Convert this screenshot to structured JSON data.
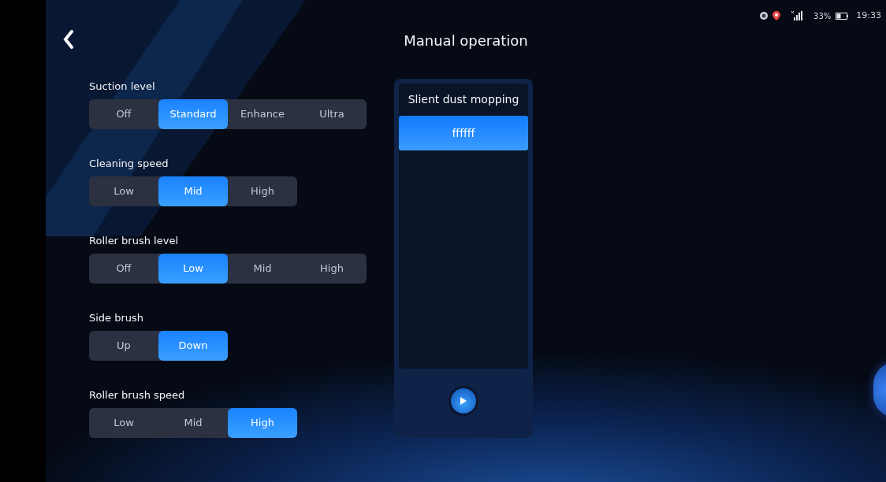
{
  "header": {
    "title": "Manual operation"
  },
  "status_bar": {
    "battery": "33%",
    "time": "19:33"
  },
  "settings": [
    {
      "label": "Suction level",
      "options": [
        {
          "label": "Off",
          "selected": false
        },
        {
          "label": "Standard",
          "selected": true
        },
        {
          "label": "Enhance",
          "selected": false
        },
        {
          "label": "Ultra",
          "selected": false
        }
      ]
    },
    {
      "label": "Cleaning speed",
      "options": [
        {
          "label": "Low",
          "selected": false
        },
        {
          "label": "Mid",
          "selected": true
        },
        {
          "label": "High",
          "selected": false
        }
      ]
    },
    {
      "label": "Roller brush level",
      "options": [
        {
          "label": "Off",
          "selected": false
        },
        {
          "label": "Low",
          "selected": true
        },
        {
          "label": "Mid",
          "selected": false
        },
        {
          "label": "High",
          "selected": false
        }
      ]
    },
    {
      "label": "Side brush",
      "options": [
        {
          "label": "Up",
          "selected": false
        },
        {
          "label": "Down",
          "selected": true
        }
      ]
    },
    {
      "label": "Roller brush speed",
      "options": [
        {
          "label": "Low",
          "selected": false
        },
        {
          "label": "Mid",
          "selected": false
        },
        {
          "label": "High",
          "selected": true
        }
      ]
    }
  ],
  "mode_panel": {
    "title": "Slient dust mopping",
    "items": [
      {
        "label": "ffffff",
        "selected": true
      }
    ]
  }
}
